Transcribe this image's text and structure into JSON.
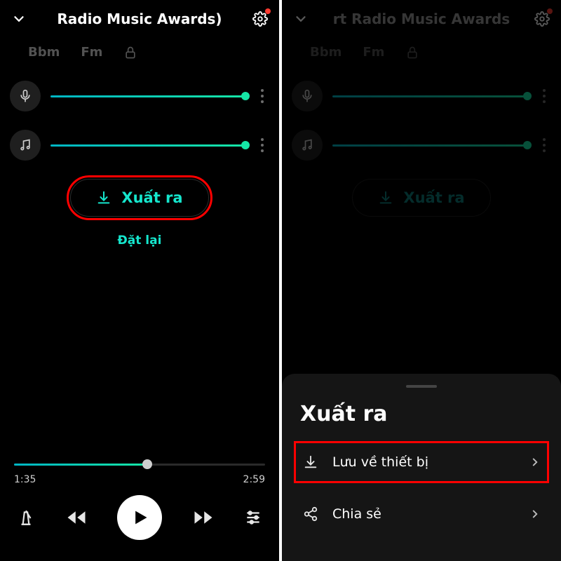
{
  "header": {
    "title": "Radio Music Awards)"
  },
  "header_right": {
    "title": "rt Radio Music Awards"
  },
  "keys": {
    "key1": "Bbm",
    "key2": "Fm"
  },
  "icons": {
    "chevron": "chevron-down-icon",
    "gear": "gear-icon",
    "lock": "lock-icon",
    "mic": "mic-icon",
    "music": "music-icon",
    "download": "download-icon",
    "share": "share-icon",
    "metronome": "metronome-icon",
    "rewind": "rewind-icon",
    "forward": "forward-icon",
    "play": "play-icon",
    "mixer": "mixer-icon"
  },
  "export": {
    "button": "Xuất ra",
    "reset": "Đặt lại"
  },
  "playback": {
    "elapsed": "1:35",
    "total": "2:59",
    "progress": 53
  },
  "sheet": {
    "title": "Xuất ra",
    "save": "Lưu về thiết bị",
    "share": "Chia sẻ"
  },
  "colors": {
    "accent": "#15e6cd",
    "highlight": "#ff0000"
  }
}
